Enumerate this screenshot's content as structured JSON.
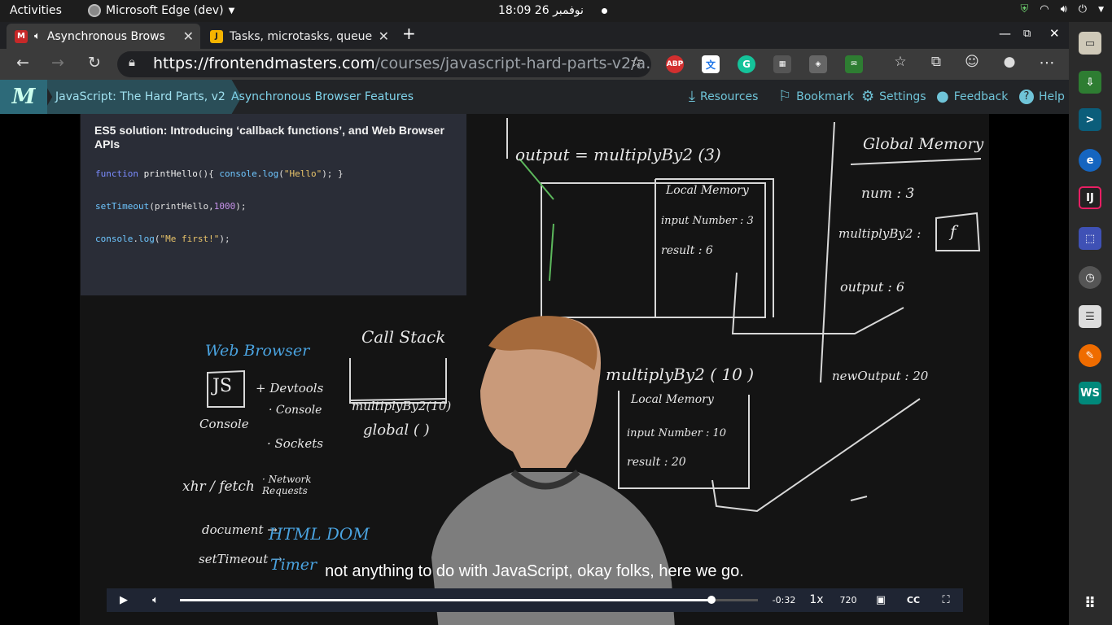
{
  "system": {
    "activities": "Activities",
    "app_name": "Microsoft Edge (dev)",
    "clock": "18:09  26 نوفمبر"
  },
  "tabs": [
    {
      "title": "Asynchronous Brows",
      "favicon": "fem-logo-icon",
      "active": true
    },
    {
      "title": "Tasks, microtasks, queue",
      "favicon": "jake-blog-icon",
      "active": false
    }
  ],
  "toolbar": {
    "url_host": "https://frontendmasters.com",
    "url_path": "/courses/javascript-hard-parts-v2/a…",
    "extensions": [
      "ABP",
      "translate",
      "G",
      "ext",
      "ext",
      "ext"
    ]
  },
  "fem": {
    "logo": "M",
    "course": "JavaScript: The Hard Parts, v2",
    "lesson": "Asynchronous Browser Features",
    "links": {
      "resources": "Resources",
      "bookmark": "Bookmark",
      "settings": "Settings",
      "feedback": "Feedback",
      "help": "Help"
    }
  },
  "slide": {
    "title": "ES5 solution: Introducing ‘callback functions’, and Web Browser APIs",
    "code": [
      "function printHello(){ console.log(\"Hello\"); }",
      "setTimeout(printHello,1000);",
      "console.log(\"Me first!\");"
    ]
  },
  "board": {
    "output_line": "output  =  multiplyBy2 (3)",
    "local_memory_1": "Local Memory",
    "input_number_1": "input Number :  3",
    "result_1": "result  :  6",
    "global_memory": "Global Memory",
    "num": "num  :  3",
    "multiplyBy2": "multiplyBy2 :",
    "f": "f",
    "output": "output  :  6",
    "web_browser": "Web Browser",
    "call_stack": "Call Stack",
    "js": "JS",
    "devtools": "+ Devtools",
    "console_label": "Console",
    "console_api": "· Console",
    "sockets": "· Sockets",
    "xhr": "xhr / fetch",
    "network": "· Network Requests",
    "document": "document →",
    "html_dom": "HTML DOM",
    "settimeout": "setTimeout →",
    "timer": "Timer",
    "stack_top": "multiplyBy2(10)",
    "stack_global": "global ( )",
    "multiply10": "multiplyBy2 ( 10 )",
    "local_memory_2": "Local Memory",
    "input_number_2": "input Number :  10",
    "result_2": "result  :  20",
    "new_output": "newOutput  :  20"
  },
  "video": {
    "caption": "not anything to do with JavaScript, okay folks, here we go.",
    "time_remaining": "-0:32",
    "speed": "1x",
    "quality": "720",
    "progress": 0.92
  }
}
